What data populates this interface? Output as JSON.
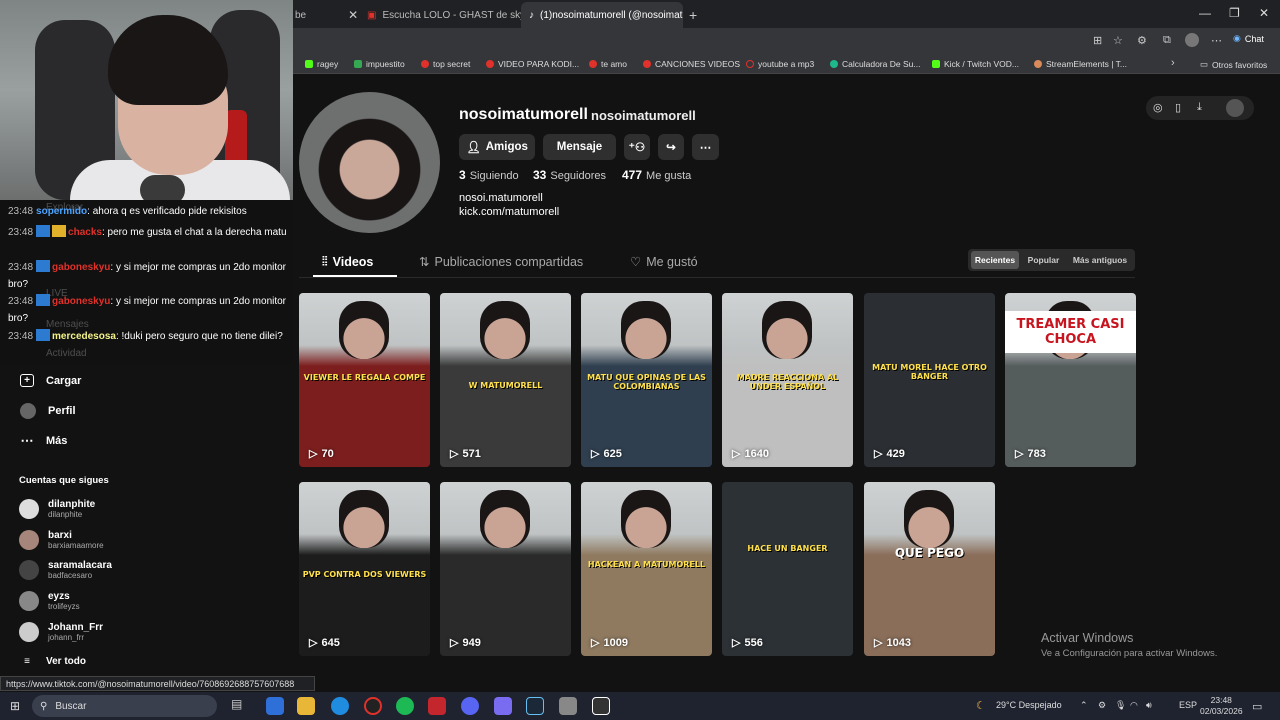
{
  "browser": {
    "tabs": [
      {
        "title": "be"
      },
      {
        "title": "Escucha LOLO - GHAST de skyde:"
      },
      {
        "title": "(1)nosoimatumorell (@nosoimatu"
      }
    ],
    "new_tab": "+",
    "chat_label": "Chat",
    "bookmarks": [
      "ragey",
      "impuestito",
      "top secret",
      "VIDEO PARA KODI...",
      "te amo",
      "CANCIONES VIDEOS",
      "youtube a mp3",
      "Calculadora De Su...",
      "Kick / Twitch VOD...",
      "StreamElements | T...",
      "Otros favoritos"
    ],
    "status_url": "https://www.tiktok.com/@nosoimatumorell/video/7608692688757607688"
  },
  "chat": {
    "messages": [
      {
        "time": "23:48",
        "user": "sopermido",
        "user_color": "#4aa3ff",
        "text": "ahora q es verificado pide rekisitos"
      },
      {
        "time": "23:48",
        "user": "chacks",
        "user_color": "#e0312b",
        "text": "pero me gusta el chat a la derecha matu"
      },
      {
        "time": "23:48",
        "user": "gaboneskyu",
        "user_color": "#e0312b",
        "text": "y si mejor me compras un 2do monitor bro?"
      },
      {
        "time": "23:48",
        "user": "gaboneskyu",
        "user_color": "#e0312b",
        "text": "y si mejor me compras un 2do monitor bro?"
      },
      {
        "time": "23:48",
        "user": "mercedesosa",
        "user_color": "#f3f38a",
        "text": "!duki pero seguro que no tiene dilei?"
      }
    ],
    "ghost_items": [
      "Explorar",
      "LIVE",
      "Mensajes",
      "Actividad"
    ]
  },
  "sidebar": {
    "items": [
      {
        "label": "Cargar",
        "icon": "upload-icon"
      },
      {
        "label": "Perfil",
        "icon": "profile-icon"
      },
      {
        "label": "Más",
        "icon": "more-icon"
      }
    ],
    "following_heading": "Cuentas que sigues",
    "accounts": [
      {
        "name": "dilanphite",
        "user": "dilanphite"
      },
      {
        "name": "barxi",
        "user": "barxiamaamore"
      },
      {
        "name": "saramalacara",
        "user": "badfacesaro"
      },
      {
        "name": "eyzs",
        "user": "trolifeyzs"
      },
      {
        "name": "Johann_Frr",
        "user": "johann_frr"
      }
    ],
    "see_all": "Ver todo"
  },
  "profile": {
    "display_name": "nosoimatumorell",
    "username": "nosoimatumorell",
    "buttons": {
      "friends": "Amigos",
      "message": "Mensaje"
    },
    "stats": [
      {
        "value": "3",
        "label": "Siguiendo"
      },
      {
        "value": "33",
        "label": "Seguidores"
      },
      {
        "value": "477",
        "label": "Me gusta"
      }
    ],
    "bio": [
      "nosoi.matumorell",
      "kick.com/matumorell"
    ],
    "tabs": [
      {
        "label": "Videos"
      },
      {
        "label": "Publicaciones compartidas"
      },
      {
        "label": "Me gustó"
      }
    ],
    "sort_options": [
      "Recientes",
      "Popular",
      "Más antiguos"
    ],
    "sort_selected": "Recientes"
  },
  "videos": [
    {
      "views": "70",
      "caption": "VIEWER LE REGALA COMPE",
      "bg": "#7d1e1e"
    },
    {
      "views": "571",
      "caption": "W MATUMORELL",
      "bg": "#3a3a3a"
    },
    {
      "views": "625",
      "caption": "MATU QUE OPINAS DE LAS COLOMBIANAS",
      "bg": "#2f3f4f"
    },
    {
      "views": "1640",
      "caption": "MADRE REACCIONA AL UNDER ESPAÑOL",
      "bg": "#bfbfbf"
    },
    {
      "views": "429",
      "caption": "MATU MOREL HACE OTRO BANGER",
      "bg": "#2b2f33"
    },
    {
      "views": "783",
      "caption": "TREAMER CASI CHOCA",
      "bg": "#555c5c"
    },
    {
      "views": "645",
      "caption": "PVP CONTRA DOS VIEWERS",
      "bg": "#1c1c1c"
    },
    {
      "views": "949",
      "caption": "",
      "bg": "#2a2a2a"
    },
    {
      "views": "1009",
      "caption": "HACKEAN A MATUMORELL",
      "bg": "#8f7a60"
    },
    {
      "views": "556",
      "caption": "HACE UN BANGER",
      "bg": "#2c3135"
    },
    {
      "views": "1043",
      "caption": "QUE PEGO",
      "bg": "#8a6e5a"
    }
  ],
  "watermark": {
    "line1": "Activar Windows",
    "line2": "Ve a Configuración para activar Windows."
  },
  "taskbar": {
    "search_placeholder": "Buscar",
    "weather": "29°C  Despejado",
    "lang": "ESP",
    "time": "23:48",
    "date": "02/03/2026"
  }
}
